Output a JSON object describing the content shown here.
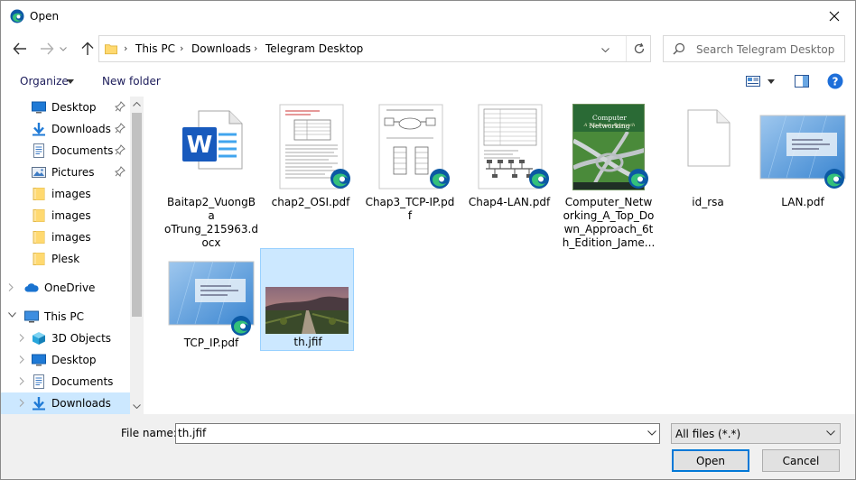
{
  "window": {
    "title": "Open"
  },
  "nav": {
    "breadcrumb": [
      "This PC",
      "Downloads",
      "Telegram Desktop"
    ],
    "search_placeholder": "Search Telegram Desktop"
  },
  "toolbar": {
    "organize": "Organize",
    "new_folder": "New folder"
  },
  "sidebar": {
    "items": [
      {
        "label": "Desktop",
        "icon": "desktop-icon",
        "pinned": true
      },
      {
        "label": "Downloads",
        "icon": "download-icon",
        "pinned": true
      },
      {
        "label": "Documents",
        "icon": "documents-icon",
        "pinned": true
      },
      {
        "label": "Pictures",
        "icon": "pictures-icon",
        "pinned": true
      },
      {
        "label": "images",
        "icon": "folder-icon",
        "pinned": false
      },
      {
        "label": "images",
        "icon": "folder-icon",
        "pinned": false
      },
      {
        "label": "images",
        "icon": "folder-icon",
        "pinned": false
      },
      {
        "label": "Plesk",
        "icon": "folder-icon",
        "pinned": false
      },
      {
        "label": "OneDrive",
        "icon": "cloud-icon",
        "pinned": false
      },
      {
        "label": "This PC",
        "icon": "computer-icon",
        "pinned": false
      },
      {
        "label": "3D Objects",
        "icon": "cube-icon",
        "pinned": false
      },
      {
        "label": "Desktop",
        "icon": "desktop-icon",
        "pinned": false
      },
      {
        "label": "Documents",
        "icon": "documents-icon",
        "pinned": false
      },
      {
        "label": "Downloads",
        "icon": "download-icon",
        "pinned": false,
        "selected": true
      }
    ]
  },
  "files": [
    {
      "name": "Baitap2_VuongBaoTrung_215963.docx",
      "lines": [
        "Baitap2_VuongBa",
        "oTrung_215963.d",
        "ocx"
      ],
      "type": "word-icon"
    },
    {
      "name": "chap2_OSI.pdf",
      "lines": [
        "chap2_OSI.pdf"
      ],
      "type": "pdf-thumbnail"
    },
    {
      "name": "Chap3_TCP-IP.pdf",
      "lines": [
        "Chap3_TCP-IP.pd",
        "f"
      ],
      "type": "pdf-thumbnail"
    },
    {
      "name": "Chap4-LAN.pdf",
      "lines": [
        "Chap4-LAN.pdf"
      ],
      "type": "pdf-thumbnail"
    },
    {
      "name": "Computer_Networking_A_Top_Down_Approach_6th_Edition_James...",
      "lines": [
        "Computer_Netw",
        "orking_A_Top_Do",
        "wn_Approach_6t",
        "h_Edition_Jame..."
      ],
      "type": "book-cover",
      "cover_title": "Computer Networking",
      "cover_subtitle": "A Top-Down Approach"
    },
    {
      "name": "id_rsa",
      "lines": [
        "id_rsa"
      ],
      "type": "blank-file-icon"
    },
    {
      "name": "LAN.pdf",
      "lines": [
        "LAN.pdf"
      ],
      "type": "slide-thumbnail"
    },
    {
      "name": "TCP_IP.pdf",
      "lines": [
        "TCP_IP.pdf"
      ],
      "type": "slide-thumbnail"
    },
    {
      "name": "th.jfif",
      "lines": [
        "th.jfif"
      ],
      "type": "photo-thumbnail",
      "selected": true
    }
  ],
  "bottom": {
    "file_name_label": "File name:",
    "file_name_value": "th.jfif",
    "file_type": "All files (*.*)",
    "open": "Open",
    "cancel": "Cancel"
  },
  "colors": {
    "selection": "#cce8ff",
    "accent": "#0078d7",
    "help": "#1e6fd9"
  }
}
